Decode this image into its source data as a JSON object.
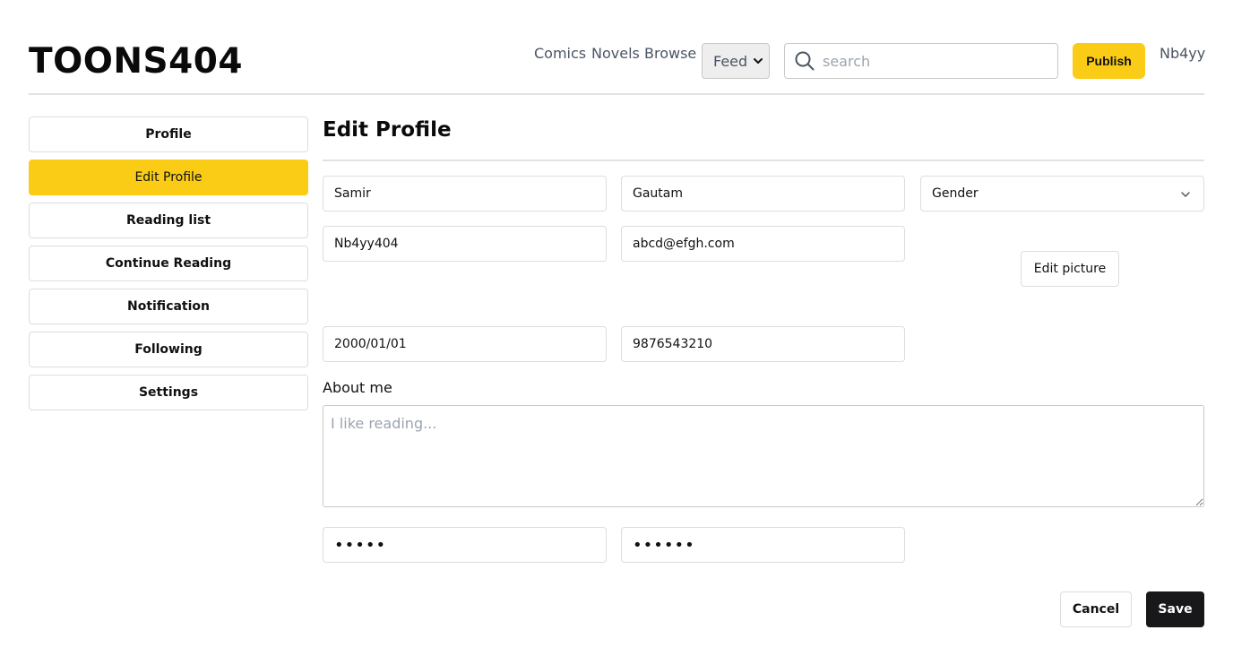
{
  "header": {
    "logo": "TOONS404",
    "nav": {
      "comics": "Comics",
      "novels": "Novels",
      "browse": "Browse"
    },
    "feed_select": {
      "value": "Feed",
      "icon": "chevron-down-icon"
    },
    "search": {
      "placeholder": "search",
      "value": "",
      "icon": "search-icon"
    },
    "publish_label": "Publish",
    "username": "Nb4yy"
  },
  "sidebar": {
    "items": [
      {
        "label": "Profile",
        "active": false
      },
      {
        "label": "Edit Profile",
        "active": true
      },
      {
        "label": "Reading list",
        "active": false
      },
      {
        "label": "Continue Reading",
        "active": false
      },
      {
        "label": "Notification",
        "active": false
      },
      {
        "label": "Following",
        "active": false
      },
      {
        "label": "Settings",
        "active": false
      }
    ]
  },
  "main": {
    "title": "Edit Profile",
    "fields": {
      "first_name": "Samir",
      "last_name": "Gautam",
      "gender": "Gender",
      "username": "Nb4yy404",
      "email": "abcd@efgh.com",
      "birthdate": "2000/01/01",
      "phone": "9876543210",
      "password": "•••••",
      "confirm_password": "••••••"
    },
    "edit_picture_label": "Edit picture",
    "about": {
      "label": "About me",
      "placeholder": "I like reading...",
      "value": ""
    },
    "actions": {
      "cancel_label": "Cancel",
      "save_label": "Save"
    }
  },
  "colors": {
    "accent": "#facc15",
    "save_button": "#18181b",
    "border": "#dddddd",
    "muted_text": "#4b5563"
  }
}
